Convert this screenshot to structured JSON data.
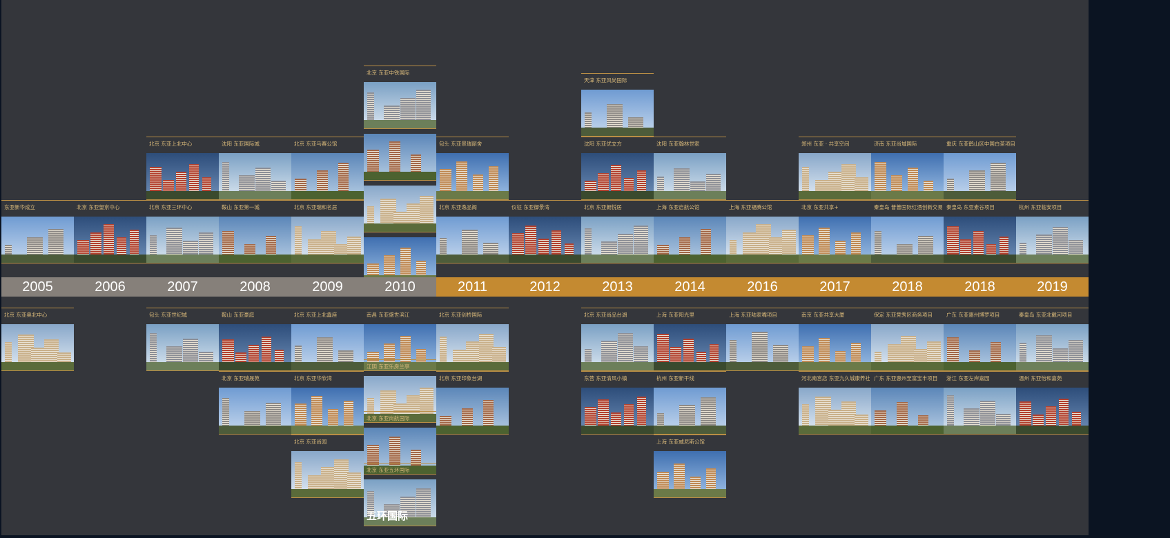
{
  "colors": {
    "background": "#0b1422",
    "column": "#34363b",
    "year_gray": "#86807a",
    "year_gold": "#c48a31",
    "rule_gold": "#b98e45",
    "label_gold": "#d9b97a"
  },
  "timeline": [
    {
      "year": "2005",
      "tone": "gray",
      "upper": [
        "东亚新华成立"
      ],
      "lower": [
        "北京 东亚奥北中心"
      ]
    },
    {
      "year": "2006",
      "tone": "gray",
      "upper": [
        "北京 东亚望京中心"
      ],
      "lower": []
    },
    {
      "year": "2007",
      "tone": "gray",
      "upper": [
        "北京 东亚三环中心",
        "北京 东亚上北中心"
      ],
      "lower": [
        "包头 东亚世纪城"
      ]
    },
    {
      "year": "2008",
      "tone": "gray",
      "upper": [
        "鞍山 东亚第一城",
        "沈阳 东亚国际城"
      ],
      "lower": [
        "鞍山 东亚豪庭",
        "北京 东亚瑞晟苑"
      ]
    },
    {
      "year": "2009",
      "tone": "gray",
      "upper": [
        "北京 东亚瑞和名居",
        "北京 东亚马赛公馆"
      ],
      "lower": [
        "北京 东亚上北鑫座",
        "北京 东亚华欣湾",
        "北京 东亚尚园"
      ]
    },
    {
      "year": "2010",
      "tone": "gray",
      "upper": [
        "东营 东亚丽景小镇",
        "南昌 东亚鹏阳 SOHO",
        "宿迁 东亚马赛公馆",
        "北京 东亚中铁国际"
      ],
      "lower": [
        "南昌 东亚盛世滨江",
        "江阴 东亚乐房兰亭",
        "北京 东亚尚航国际",
        "北京 东亚五环国际"
      ],
      "sign": "五环国际"
    },
    {
      "year": "2011",
      "tone": "gold",
      "upper": [
        "北京 东亚逸品阁",
        "包头 东亚景瑞丽舍"
      ],
      "lower": [
        "北京 东亚剑桥国际",
        "北京 东亚印象台湖"
      ]
    },
    {
      "year": "2012",
      "tone": "gold",
      "upper": [
        "仪征 东亚御景湾"
      ],
      "lower": []
    },
    {
      "year": "2013",
      "tone": "gold",
      "upper": [
        "北京 东亚朗悦居",
        "沈阳 东亚优立方",
        "天津 东亚风尚国际"
      ],
      "lower": [
        "北京 东亚尚品台湖",
        "东营 东亚清风小镇"
      ]
    },
    {
      "year": "2014",
      "tone": "gold",
      "upper": [
        "上海 东亚启航公馆",
        "沈阳 东亚翰林世家"
      ],
      "lower": [
        "上海 东亚阳光里",
        "杭州 东亚新干线",
        "上海 东亚威尼斯公馆"
      ]
    },
    {
      "year": "2016",
      "tone": "gold",
      "upper": [
        "上海 东亚福腾公馆"
      ],
      "lower": [
        "上海 东亚陆家嘴项目"
      ]
    },
    {
      "year": "2017",
      "tone": "gold",
      "upper": [
        "北京 东亚共享+",
        "郑州 东亚 · 共享空间"
      ],
      "lower": [
        "南京 东亚共享大厦",
        "河北南宫店 东亚九久城康养社区"
      ]
    },
    {
      "year": "2018",
      "tone": "gold",
      "upper": [
        "秦皇岛 普普国际红酒创新交易中心",
        "济南 东亚尚城国际"
      ],
      "lower": [
        "保定 东亚竞秀区商务项目",
        "广东 东亚惠州至富宝丰项目"
      ]
    },
    {
      "year": "2018",
      "tone": "gold",
      "upper": [
        "秦皇岛 东亚素谷项目",
        "重庆 东亚鹤山区中国白茶项目"
      ],
      "lower": [
        "广东 东亚惠州博罗项目",
        "浙江 东亚左岸嘉园"
      ]
    },
    {
      "year": "2019",
      "tone": "gold",
      "upper": [
        "杭州 东亚临安项目"
      ],
      "lower": [
        "秦皇岛 东亚北戴河项目",
        "温州 东亚怡和嘉苑"
      ]
    }
  ]
}
